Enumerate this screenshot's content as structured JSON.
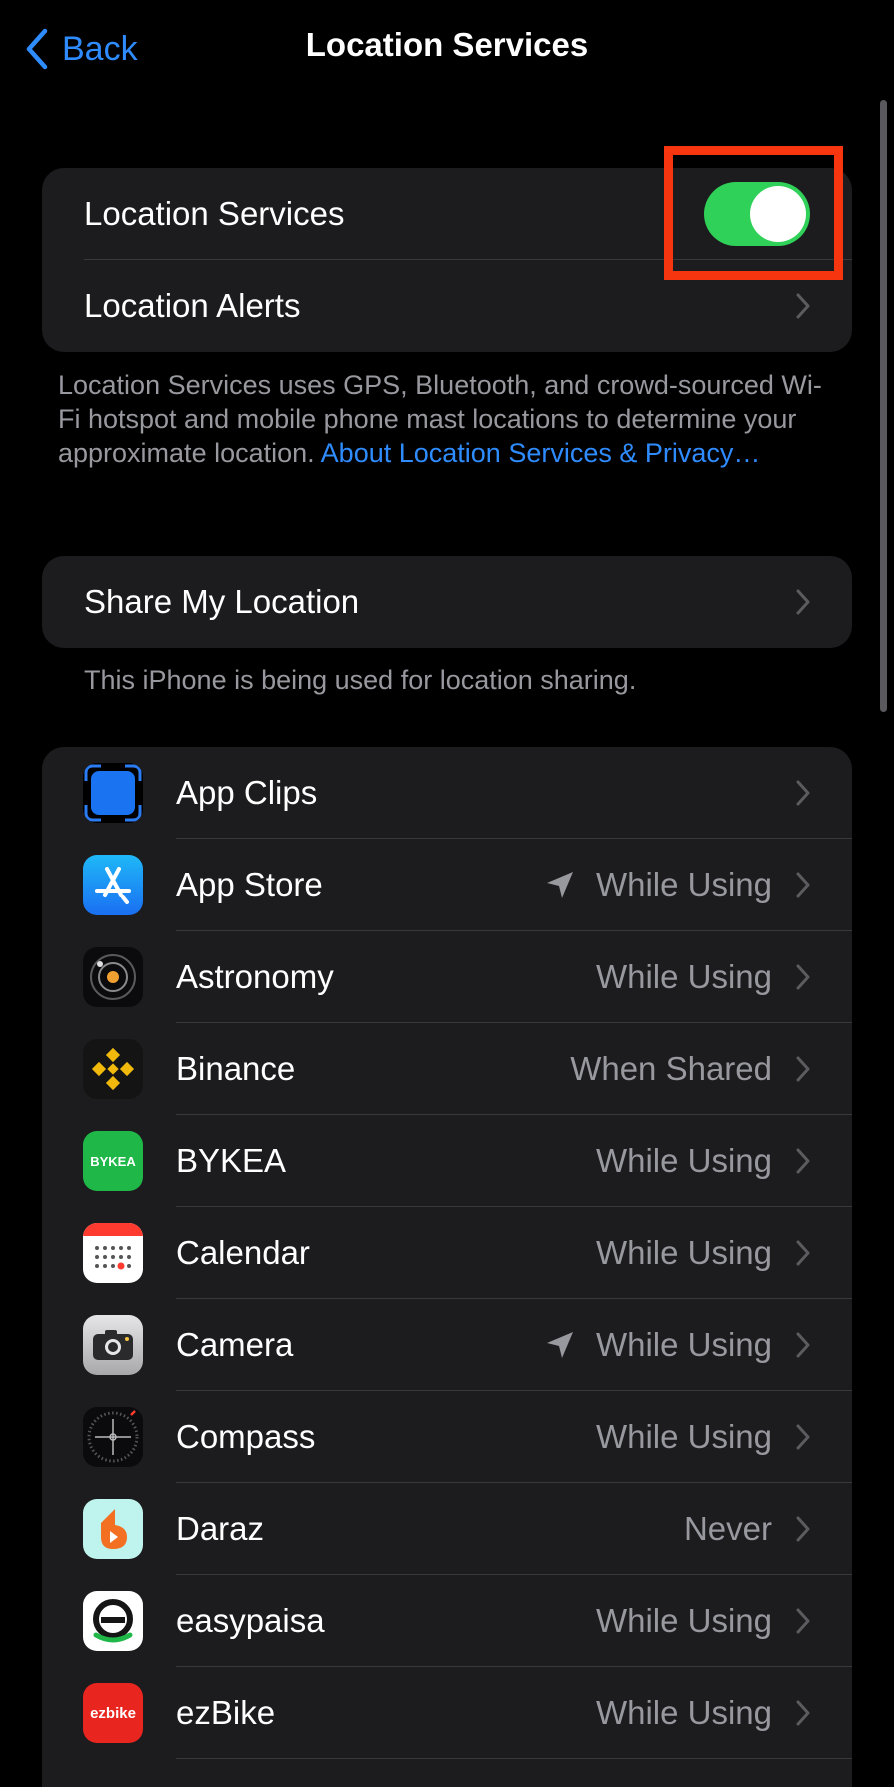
{
  "nav": {
    "back_label": "Back",
    "title": "Location Services"
  },
  "top_group": {
    "location_services_label": "Location Services",
    "location_services_on": true,
    "location_alerts_label": "Location Alerts"
  },
  "description": {
    "text": "Location Services uses GPS, Bluetooth, and crowd-sourced Wi-Fi hotspot and mobile phone mast locations to determine your approximate location.",
    "link": "About Location Services & Privacy…"
  },
  "share": {
    "label": "Share My Location",
    "footnote": "This iPhone is being used for location sharing."
  },
  "apps": [
    {
      "name": "App Clips",
      "status": "",
      "arrow": false,
      "icon": "app-clips-icon"
    },
    {
      "name": "App Store",
      "status": "While Using",
      "arrow": true,
      "icon": "app-store-icon"
    },
    {
      "name": "Astronomy",
      "status": "While Using",
      "arrow": false,
      "icon": "astronomy-icon"
    },
    {
      "name": "Binance",
      "status": "When Shared",
      "arrow": false,
      "icon": "binance-icon"
    },
    {
      "name": "BYKEA",
      "status": "While Using",
      "arrow": false,
      "icon": "bykea-icon",
      "icon_text": "BYKEA"
    },
    {
      "name": "Calendar",
      "status": "While Using",
      "arrow": false,
      "icon": "calendar-icon"
    },
    {
      "name": "Camera",
      "status": "While Using",
      "arrow": true,
      "icon": "camera-icon"
    },
    {
      "name": "Compass",
      "status": "While Using",
      "arrow": false,
      "icon": "compass-icon"
    },
    {
      "name": "Daraz",
      "status": "Never",
      "arrow": false,
      "icon": "daraz-icon"
    },
    {
      "name": "easypaisa",
      "status": "While Using",
      "arrow": false,
      "icon": "easypaisa-icon"
    },
    {
      "name": "ezBike",
      "status": "While Using",
      "arrow": false,
      "icon": "ezbike-icon",
      "icon_text": "ezbike"
    }
  ],
  "colors": {
    "accent": "#2f8cff",
    "toggle_on": "#30d158",
    "highlight_box": "#f7360f",
    "group_bg": "#1c1c1e",
    "secondary_text": "#98989f"
  }
}
